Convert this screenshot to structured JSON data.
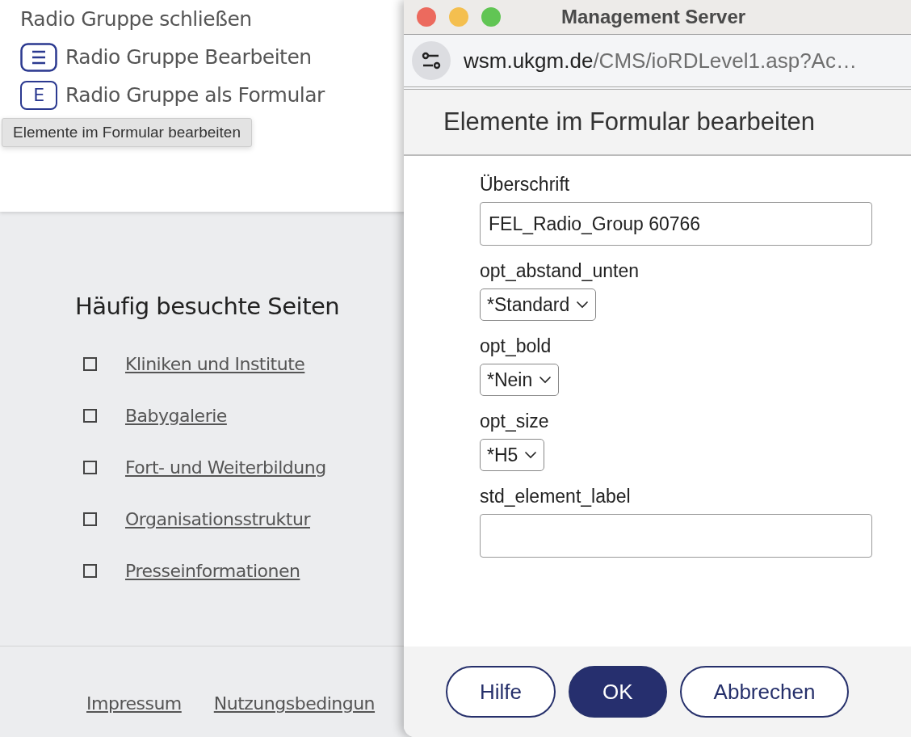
{
  "page": {
    "menu_items": [
      {
        "label": "Radio Gruppe schließen",
        "kind": "plain"
      },
      {
        "label": "Radio Gruppe Bearbeiten",
        "kind": "list"
      },
      {
        "label": "Radio Gruppe als Formular",
        "kind": "letter",
        "icon_text": "E"
      }
    ],
    "tooltip": "Elemente im Formular bearbeiten",
    "section_title": "Häufig besuchte Seiten",
    "links": [
      "Kliniken und Institute",
      "Babygalerie",
      "Fort- und Weiterbildung",
      "Organisationsstruktur",
      "Presseinformationen"
    ],
    "footer_links": [
      "Impressum",
      "Nutzungsbedingun"
    ]
  },
  "window": {
    "title": "Management Server",
    "url_domain": "wsm.ukgm.de",
    "url_path": "/CMS/ioRDLevel1.asp?Ac…",
    "dialog_title": "Elemente im Formular bearbeiten",
    "fields": [
      {
        "kind": "text",
        "label": "Überschrift",
        "value": "FEL_Radio_Group 60766"
      },
      {
        "kind": "select",
        "label": "opt_abstand_unten",
        "value": "*Standard"
      },
      {
        "kind": "select",
        "label": "opt_bold",
        "value": "*Nein"
      },
      {
        "kind": "select",
        "label": "opt_size",
        "value": "*H5"
      },
      {
        "kind": "text",
        "label": "std_element_label"
      }
    ],
    "buttons": [
      {
        "label": "Hilfe",
        "primary": false
      },
      {
        "label": "OK",
        "primary": true
      },
      {
        "label": "Abbrechen",
        "primary": false
      }
    ]
  }
}
